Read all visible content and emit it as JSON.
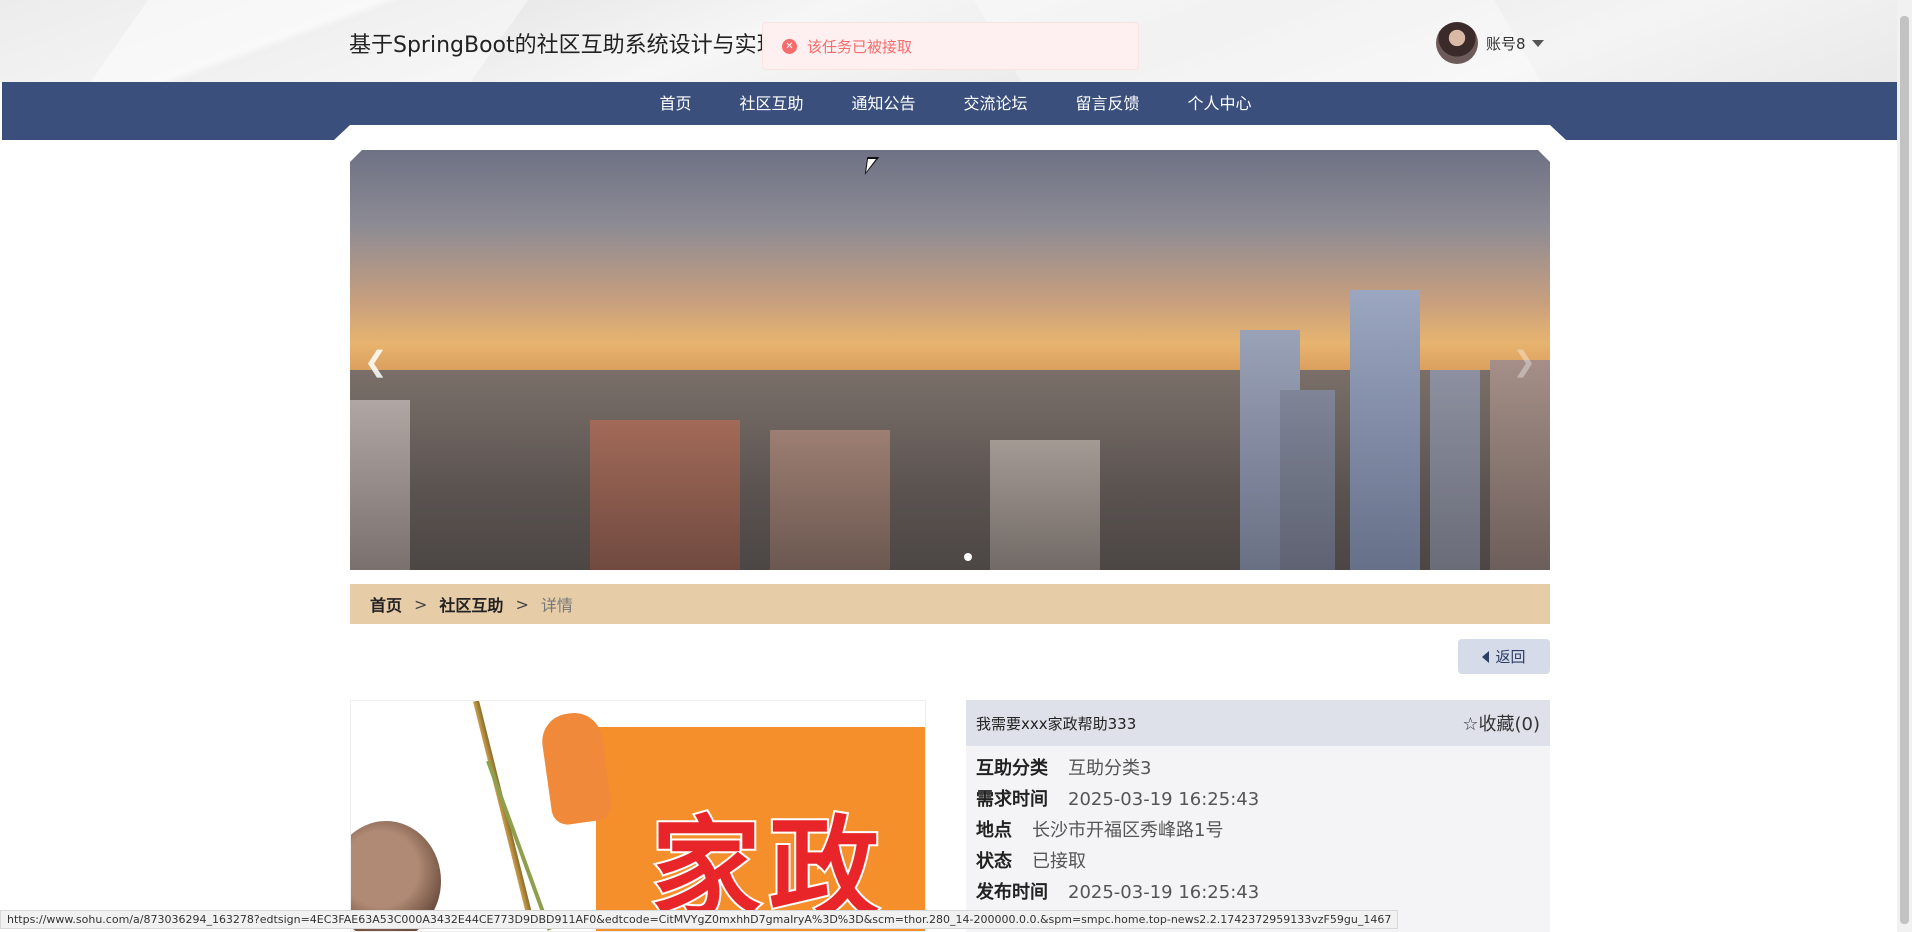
{
  "header": {
    "site_title": "基于SpringBoot的社区互助系统设计与实现",
    "user_name": "账号8"
  },
  "toast": {
    "message": "该任务已被接取",
    "icon": "error-circle-icon",
    "color": "#f56c6c"
  },
  "nav": {
    "items": [
      "首页",
      "社区互助",
      "通知公告",
      "交流论坛",
      "留言反馈",
      "个人中心"
    ],
    "background": "#3a4f7c"
  },
  "banner": {
    "prev_icon": "chevron-left-icon",
    "next_icon": "chevron-right-icon",
    "active_slide": 1
  },
  "breadcrumb": {
    "home": "首页",
    "section": "社区互助",
    "current": "详情",
    "separator": ">"
  },
  "back_button": {
    "label": "返回"
  },
  "detail": {
    "title": "我需要xxx家政帮助333",
    "favorite_label": "☆收藏(0)",
    "image_caption": "家政",
    "rows": [
      {
        "label": "互助分类",
        "value": "互助分类3"
      },
      {
        "label": "需求时间",
        "value": "2025-03-19 16:25:43"
      },
      {
        "label": "地点",
        "value": "长沙市开福区秀峰路1号"
      },
      {
        "label": "状态",
        "value": "已接取"
      },
      {
        "label": "发布时间",
        "value": "2025-03-19 16:25:43"
      }
    ]
  },
  "status_bar": {
    "url": "https://www.sohu.com/a/873036294_163278?edtsign=4EC3FAE63A53C000A3432E44CE773D9DBD911AF0&edtcode=CitMVYgZ0mxhhD7gmaIryA%3D%3D&scm=thor.280_14-200000.0.0.&spm=smpc.home.top-news2.2.1742372959133vzF59gu_1467"
  }
}
